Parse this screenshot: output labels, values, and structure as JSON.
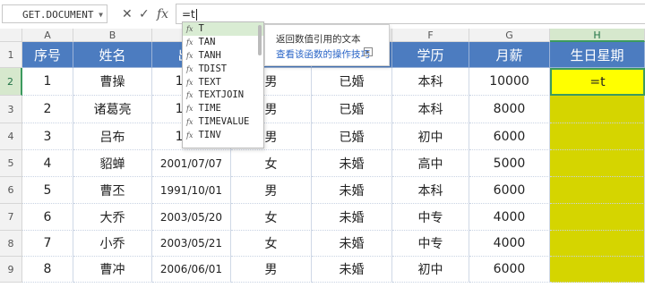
{
  "formula_bar": {
    "name_box": "GET.DOCUMENT",
    "cancel_glyph": "✕",
    "confirm_glyph": "✓",
    "fx_label": "fx",
    "formula": "=t"
  },
  "columns": [
    "A",
    "B",
    "C",
    "D",
    "E",
    "F",
    "G",
    "H"
  ],
  "rows": [
    "1",
    "2",
    "3",
    "4",
    "5",
    "6",
    "7",
    "8",
    "9"
  ],
  "headers": [
    "序号",
    "姓名",
    "出生",
    "",
    "婚否",
    "学历",
    "月薪",
    "生日星期"
  ],
  "data": [
    [
      "1",
      "曹操",
      "1976",
      "男",
      "已婚",
      "本科",
      "10000",
      "=t"
    ],
    [
      "2",
      "诸葛亮",
      "1981",
      "男",
      "已婚",
      "本科",
      "8000",
      ""
    ],
    [
      "3",
      "吕布",
      "1991",
      "男",
      "已婚",
      "初中",
      "6000",
      ""
    ],
    [
      "4",
      "貂蝉",
      "2001/07/07",
      "女",
      "未婚",
      "高中",
      "5000",
      ""
    ],
    [
      "5",
      "曹丕",
      "1991/10/01",
      "男",
      "未婚",
      "本科",
      "6000",
      ""
    ],
    [
      "6",
      "大乔",
      "2003/05/20",
      "女",
      "未婚",
      "中专",
      "4000",
      ""
    ],
    [
      "7",
      "小乔",
      "2003/05/21",
      "女",
      "未婚",
      "中专",
      "4000",
      ""
    ],
    [
      "8",
      "曹冲",
      "2006/06/01",
      "男",
      "未婚",
      "初中",
      "6000",
      ""
    ]
  ],
  "autocomplete": {
    "fx": "fx",
    "items": [
      "T",
      "TAN",
      "TANH",
      "TDIST",
      "TEXT",
      "TEXTJOIN",
      "TIME",
      "TIMEVALUE",
      "TINV"
    ]
  },
  "tooltip": {
    "description": "返回数值引用的文本",
    "link": "查看该函数的操作技巧",
    "button": "▸"
  },
  "colors": {
    "header_bg": "#4c7cc0",
    "highlight_col": "#d5d500",
    "active_cell": "#ffff00"
  }
}
